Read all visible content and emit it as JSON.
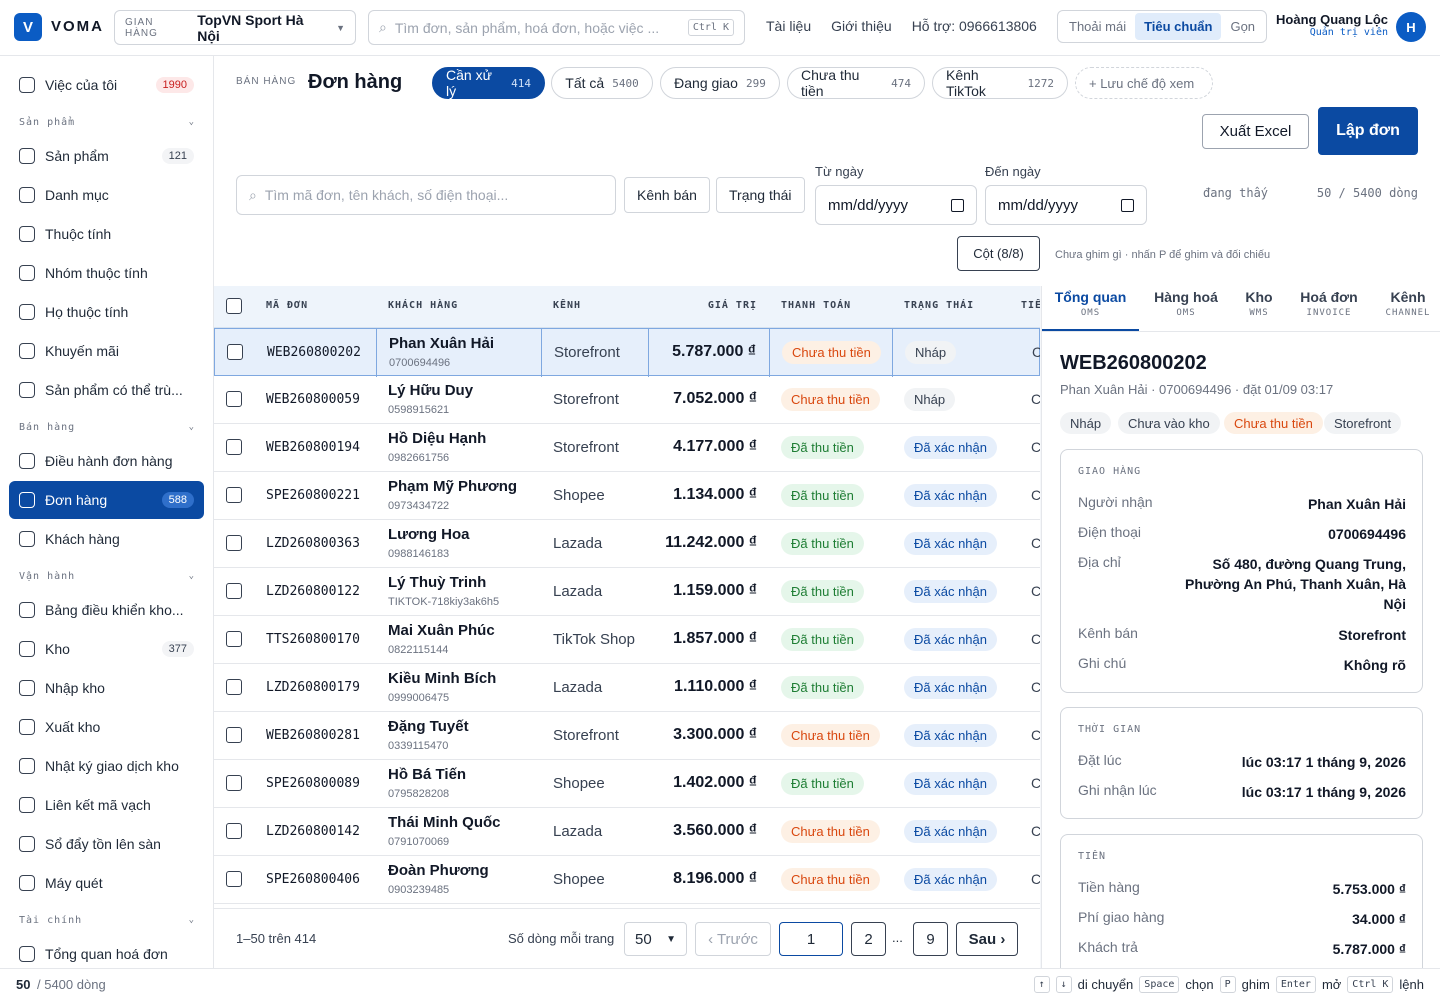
{
  "app": {
    "logo_letter": "V",
    "brand": "VOMA"
  },
  "store": {
    "label": "GIAN HÀNG",
    "value": "TopVN Sport Hà Nội"
  },
  "global_search": {
    "placeholder": "Tìm đơn, sản phẩm, hoá đơn, hoặc việc ...",
    "shortcut": "Ctrl K"
  },
  "top_links": [
    "Tài liệu",
    "Giới thiệu",
    "Hỗ trợ: 0966613806"
  ],
  "density": {
    "options": [
      "Thoải mái",
      "Tiêu chuẩn",
      "Gọn"
    ],
    "selected": "Tiêu chuẩn"
  },
  "user": {
    "name": "Hoàng Quang Lộc",
    "role": "Quản trị viên",
    "initial": "H"
  },
  "sidebar": {
    "top": {
      "label": "Việc của tôi",
      "count": "1990"
    },
    "sections": [
      {
        "title": "Sản phẩm",
        "items": [
          {
            "label": "Sản phẩm",
            "count": "121"
          },
          {
            "label": "Danh mục"
          },
          {
            "label": "Thuộc tính"
          },
          {
            "label": "Nhóm thuộc tính"
          },
          {
            "label": "Họ thuộc tính"
          },
          {
            "label": "Khuyến mãi"
          },
          {
            "label": "Sản phẩm có thể trù..."
          }
        ]
      },
      {
        "title": "Bán hàng",
        "items": [
          {
            "label": "Điều hành đơn hàng"
          },
          {
            "label": "Đơn hàng",
            "count": "588",
            "active": true
          },
          {
            "label": "Khách hàng"
          }
        ]
      },
      {
        "title": "Vận hành",
        "items": [
          {
            "label": "Bảng điều khiển kho..."
          },
          {
            "label": "Kho",
            "count": "377"
          },
          {
            "label": "Nhập kho"
          },
          {
            "label": "Xuất kho"
          },
          {
            "label": "Nhật ký giao dịch kho"
          },
          {
            "label": "Liên kết mã vạch"
          },
          {
            "label": "Sổ đẩy tồn lên sàn"
          },
          {
            "label": "Máy quét"
          }
        ]
      },
      {
        "title": "Tài chính",
        "items": [
          {
            "label": "Tổng quan hoá đơn"
          }
        ]
      }
    ]
  },
  "page": {
    "crumb": "BÁN HÀNG",
    "title": "Đơn hàng"
  },
  "filters": [
    {
      "label": "Cần xử lý",
      "count": "414",
      "active": true
    },
    {
      "label": "Tất cả",
      "count": "5400"
    },
    {
      "label": "Đang giao",
      "count": "299"
    },
    {
      "label": "Chưa thu tiền",
      "count": "474"
    },
    {
      "label": "Kênh TikTok",
      "count": "1272"
    }
  ],
  "save_view": "+ Lưu chế độ xem",
  "actions": {
    "export": "Xuất Excel",
    "create": "Lập đơn"
  },
  "order_search": {
    "placeholder": "Tìm mã đơn, tên khách, số điện thoại..."
  },
  "filter_buttons": [
    "Kênh bán",
    "Trạng thái"
  ],
  "date_from": {
    "label": "Từ ngày",
    "placeholder": "mm/dd/yyyy"
  },
  "date_to": {
    "label": "Đến ngày",
    "placeholder": "mm/dd/yyyy"
  },
  "viewing": {
    "label": "đang thấy",
    "value": "50 / 5400 dòng"
  },
  "columns_button": "Cột (8/8)",
  "pin_hint": "Chưa ghim gì · nhấn P để ghim và đối chiếu",
  "table": {
    "headers": {
      "code": "MÃ ĐƠN",
      "customer": "KHÁCH HÀNG",
      "channel": "KÊNH",
      "value": "GIÁ TRỊ",
      "payment": "THANH TOÁN",
      "status": "TRẠNG THÁI",
      "extra": "TIẾ"
    },
    "rows": [
      {
        "code": "WEB260800202",
        "name": "Phan Xuân Hải",
        "phone": "0700694496",
        "channel": "Storefront",
        "value": "5.787.000 ₫",
        "payment": "Chưa thu tiền",
        "status": "Nháp",
        "extra": "C"
      },
      {
        "code": "WEB260800059",
        "name": "Lý Hữu Duy",
        "phone": "0598915621",
        "channel": "Storefront",
        "value": "7.052.000 ₫",
        "payment": "Chưa thu tiền",
        "status": "Nháp",
        "extra": "C"
      },
      {
        "code": "WEB260800194",
        "name": "Hồ Diệu Hạnh",
        "phone": "0982661756",
        "channel": "Storefront",
        "value": "4.177.000 ₫",
        "payment": "Đã thu tiền",
        "status": "Đã xác nhận",
        "extra": "C"
      },
      {
        "code": "SPE260800221",
        "name": "Phạm Mỹ Phương",
        "phone": "0973434722",
        "channel": "Shopee",
        "value": "1.134.000 ₫",
        "payment": "Đã thu tiền",
        "status": "Đã xác nhận",
        "extra": "C"
      },
      {
        "code": "LZD260800363",
        "name": "Lương Hoa",
        "phone": "0988146183",
        "channel": "Lazada",
        "value": "11.242.000 ₫",
        "payment": "Đã thu tiền",
        "status": "Đã xác nhận",
        "extra": "C"
      },
      {
        "code": "LZD260800122",
        "name": "Lý Thuỳ Trinh",
        "phone": "TIKTOK-718kiy3ak6h5",
        "channel": "Lazada",
        "value": "1.159.000 ₫",
        "payment": "Đã thu tiền",
        "status": "Đã xác nhận",
        "extra": "C"
      },
      {
        "code": "TTS260800170",
        "name": "Mai Xuân Phúc",
        "phone": "0822115144",
        "channel": "TikTok Shop",
        "value": "1.857.000 ₫",
        "payment": "Đã thu tiền",
        "status": "Đã xác nhận",
        "extra": "C"
      },
      {
        "code": "LZD260800179",
        "name": "Kiều Minh Bích",
        "phone": "0999006475",
        "channel": "Lazada",
        "value": "1.110.000 ₫",
        "payment": "Đã thu tiền",
        "status": "Đã xác nhận",
        "extra": "C"
      },
      {
        "code": "WEB260800281",
        "name": "Đặng Tuyết",
        "phone": "0339115470",
        "channel": "Storefront",
        "value": "3.300.000 ₫",
        "payment": "Chưa thu tiền",
        "status": "Đã xác nhận",
        "extra": "C"
      },
      {
        "code": "SPE260800089",
        "name": "Hồ Bá Tiến",
        "phone": "0795828208",
        "channel": "Shopee",
        "value": "1.402.000 ₫",
        "payment": "Đã thu tiền",
        "status": "Đã xác nhận",
        "extra": "C"
      },
      {
        "code": "LZD260800142",
        "name": "Thái Minh Quốc",
        "phone": "0791070069",
        "channel": "Lazada",
        "value": "3.560.000 ₫",
        "payment": "Chưa thu tiền",
        "status": "Đã xác nhận",
        "extra": "C"
      },
      {
        "code": "SPE260800406",
        "name": "Đoàn Phương",
        "phone": "0903239485",
        "channel": "Shopee",
        "value": "8.196.000 ₫",
        "payment": "Chưa thu tiền",
        "status": "Đã xác nhận",
        "extra": "C"
      }
    ]
  },
  "pagination": {
    "range": "1–50 trên 414",
    "per_page_label": "Số dòng mỗi trang",
    "per_page": "50",
    "prev": "‹ Trước",
    "current": "1",
    "pages": [
      "2",
      "9"
    ],
    "ellipsis": "...",
    "next": "Sau ›"
  },
  "detail": {
    "tabs": [
      {
        "label": "Tổng quan",
        "sub": "OMS",
        "active": true
      },
      {
        "label": "Hàng hoá",
        "sub": "OMS"
      },
      {
        "label": "Kho",
        "sub": "WMS"
      },
      {
        "label": "Hoá đơn",
        "sub": "INVOICE"
      },
      {
        "label": "Kênh",
        "sub": "CHANNEL"
      }
    ],
    "code": "WEB260800202",
    "subtitle": "Phan Xuân Hải · 0700694496 · đặt 01/09 03:17",
    "tags": [
      "Nháp",
      "Chưa vào kho",
      "Chưa thu tiền",
      "Storefront"
    ],
    "shipping": {
      "title": "GIAO HÀNG",
      "rows": [
        [
          "Người nhận",
          "Phan Xuân Hải"
        ],
        [
          "Điện thoại",
          "0700694496"
        ],
        [
          "Địa chỉ",
          "Số 480, đường Quang Trung, Phường An Phú, Thanh Xuân, Hà Nội"
        ],
        [
          "Kênh bán",
          "Storefront"
        ],
        [
          "Ghi chú",
          "Không rõ"
        ]
      ]
    },
    "time": {
      "title": "THỜI GIAN",
      "rows": [
        [
          "Đặt lúc",
          "lúc 03:17 1 tháng 9, 2026"
        ],
        [
          "Ghi nhận lúc",
          "lúc 03:17 1 tháng 9, 2026"
        ]
      ]
    },
    "money": {
      "title": "TIỀN",
      "rows": [
        [
          "Tiền hàng",
          "5.753.000 ₫"
        ],
        [
          "Phí giao hàng",
          "34.000 ₫"
        ],
        [
          "Khách trả",
          "5.787.000 ₫"
        ]
      ]
    }
  },
  "statusbar": {
    "count": "50",
    "total": "/ 5400 dòng",
    "hints": [
      {
        "keys": [
          "↑",
          "↓"
        ],
        "label": "di chuyển"
      },
      {
        "keys": [
          "Space"
        ],
        "label": "chọn"
      },
      {
        "keys": [
          "P"
        ],
        "label": "ghim"
      },
      {
        "keys": [
          "Enter"
        ],
        "label": "mở"
      },
      {
        "keys": [
          "Ctrl K"
        ],
        "label": "lệnh"
      }
    ]
  },
  "colors": {
    "primary": "#0b4aa2",
    "unpaid": "#d9480f",
    "paid": "#1e7e34"
  }
}
